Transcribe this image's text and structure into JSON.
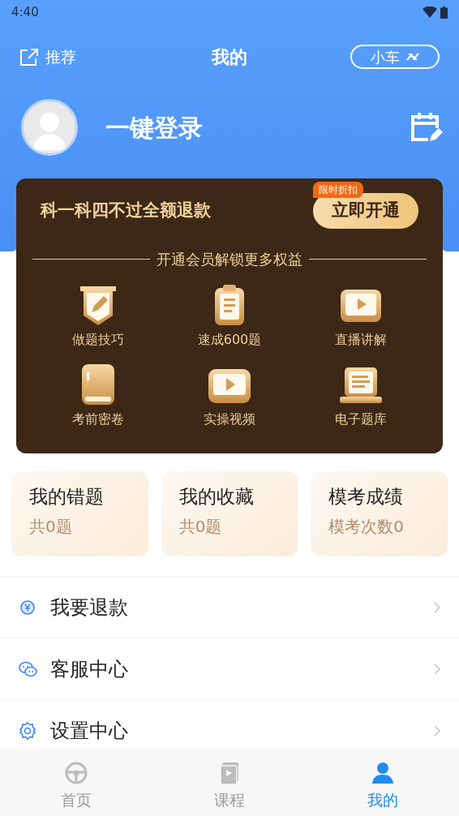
{
  "status_bar": {
    "time": "4:40"
  },
  "header": {
    "share_label": "推荐",
    "title": "我的",
    "vehicle_label": "小车"
  },
  "profile": {
    "login_label": "一键登录"
  },
  "vip_card": {
    "headline": "科一科四不过全额退款",
    "badge": "限时折扣",
    "button": "立即开通",
    "subtitle": "开通会员解锁更多权益",
    "benefits": [
      {
        "kind": "pencil",
        "label": "做题技巧"
      },
      {
        "kind": "clipboard",
        "label": "速成600题"
      },
      {
        "kind": "play",
        "label": "直播讲解"
      },
      {
        "kind": "book",
        "label": "考前密卷"
      },
      {
        "kind": "video",
        "label": "实操视频"
      },
      {
        "kind": "laptop",
        "label": "电子题库"
      }
    ]
  },
  "stats": [
    {
      "title": "我的错题",
      "value": "共0题"
    },
    {
      "title": "我的收藏",
      "value": "共0题"
    },
    {
      "title": "模考成绩",
      "value": "模考次数0"
    }
  ],
  "menu": [
    {
      "kind": "refund",
      "label": "我要退款"
    },
    {
      "kind": "chat",
      "label": "客服中心"
    },
    {
      "kind": "settings",
      "label": "设置中心"
    }
  ],
  "tab_bar": [
    {
      "kind": "wheel",
      "label": "首页",
      "selected": false
    },
    {
      "kind": "course",
      "label": "课程",
      "selected": false
    },
    {
      "kind": "person",
      "label": "我的",
      "selected": true
    }
  ]
}
